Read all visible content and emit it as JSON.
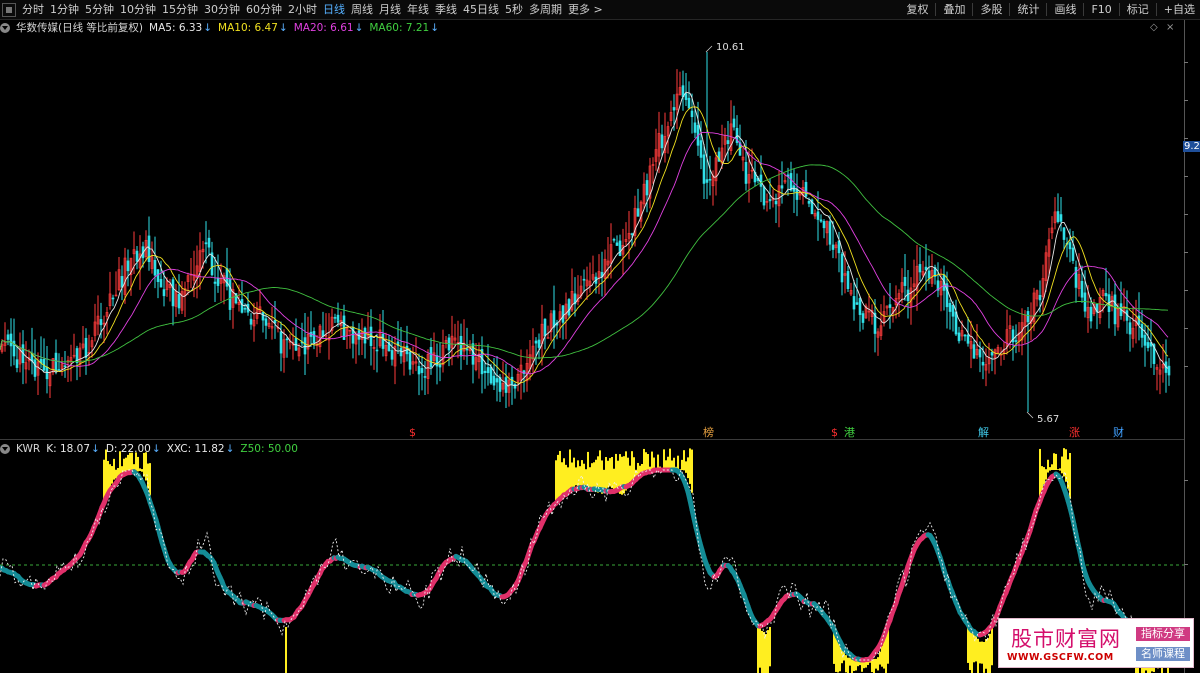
{
  "toolbar": {
    "periods": [
      "分时",
      "1分钟",
      "5分钟",
      "10分钟",
      "15分钟",
      "30分钟",
      "60分钟",
      "2小时",
      "日线",
      "周线",
      "月线",
      "年线",
      "季线",
      "45日线",
      "5秒",
      "多周期",
      "更多 >"
    ],
    "active_period": "日线",
    "actions": [
      "复权",
      "叠加",
      "多股",
      "统计",
      "画线",
      "F10",
      "标记",
      "+自选"
    ]
  },
  "main": {
    "legend": [
      {
        "text": "华数传媒(日线 等比前复权)",
        "color": "#d6d6d6"
      },
      {
        "text": "MA5: 6.33",
        "arrow": "↓",
        "color": "#e8e8e8"
      },
      {
        "text": "MA10: 6.47",
        "arrow": "↓",
        "color": "#f0e020"
      },
      {
        "text": "MA20: 6.61",
        "arrow": "↓",
        "color": "#e040e0"
      },
      {
        "text": "MA60: 7.21",
        "arrow": "↓",
        "color": "#40d040"
      }
    ],
    "high_label": "10.61",
    "low_label": "5.67",
    "markers": [
      {
        "text": "$",
        "color": "#ff3030"
      },
      {
        "text": "榜",
        "color": "#e6a040"
      },
      {
        "text": "$",
        "color": "#ff3030"
      },
      {
        "text": "港",
        "color": "#40d040"
      },
      {
        "text": "解",
        "color": "#40c8e8"
      },
      {
        "text": "涨",
        "color": "#ff3030"
      },
      {
        "text": "财",
        "color": "#40a0ff"
      }
    ]
  },
  "indicator": {
    "legend": [
      {
        "text": "KWR",
        "color": "#d6d6d6"
      },
      {
        "text": "K: 18.07",
        "arrow": "↓",
        "color": "#e8e8e8"
      },
      {
        "text": "D: 22.00",
        "arrow": "↓",
        "color": "#e8e8e8"
      },
      {
        "text": "XXC: 11.82",
        "arrow": "↓",
        "color": "#e8e8e8"
      },
      {
        "text": "Z50: 50.00",
        "color": "#40d040"
      }
    ]
  },
  "yaxis": {
    "labels": [
      "9.2"
    ]
  },
  "watermark": {
    "name": "股市财富网",
    "url": "WWW.GSCFW.COM",
    "tag1": "指标分享",
    "tag2": "名师课程"
  },
  "chart_data": {
    "type": "candlestick",
    "main": {
      "prices": [
        6.7,
        6.5,
        6.3,
        6.2,
        6.25,
        6.3,
        6.4,
        6.6,
        7.0,
        7.4,
        7.7,
        8.0,
        7.6,
        7.3,
        7.2,
        7.6,
        7.9,
        7.5,
        7.2,
        7.1,
        7.0,
        6.8,
        6.6,
        6.5,
        6.6,
        6.8,
        6.9,
        6.8,
        6.6,
        6.7,
        6.6,
        6.5,
        6.4,
        6.3,
        6.4,
        6.6,
        6.5,
        6.4,
        6.2,
        6.0,
        6.1,
        6.4,
        6.7,
        6.9,
        7.1,
        7.3,
        7.5,
        7.7,
        7.9,
        8.2,
        8.6,
        9.2,
        9.6,
        10.3,
        9.5,
        8.8,
        9.2,
        9.5,
        9.0,
        8.7,
        8.6,
        8.8,
        8.7,
        8.5,
        8.4,
        7.9,
        7.4,
        7.1,
        6.9,
        7.0,
        7.3,
        7.4,
        7.8,
        7.4,
        7.0,
        6.7,
        6.5,
        6.3,
        6.6,
        6.8,
        7.0,
        7.3,
        8.5,
        7.9,
        7.4,
        7.0,
        7.2,
        7.0,
        6.9,
        6.7,
        6.3,
        6.2
      ],
      "high": 10.61,
      "low": 5.67,
      "ma5_last": 6.33,
      "ma10_last": 6.47,
      "ma20_last": 6.61,
      "ma60_last": 7.21
    },
    "indicator": {
      "name": "KWR",
      "k_last": 18.07,
      "d_last": 22.0,
      "xxc_last": 11.82,
      "z50": 50.0
    }
  }
}
